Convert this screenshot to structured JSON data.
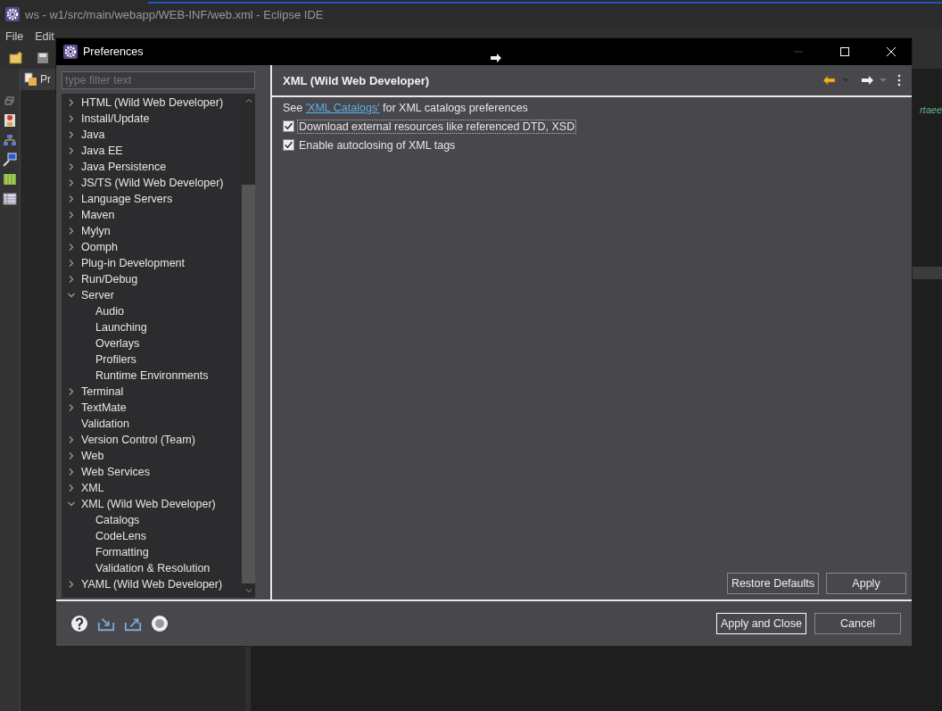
{
  "ide": {
    "title": "ws - w1/src/main/webapp/WEB-INF/web.xml - Eclipse IDE",
    "menu": [
      "File",
      "Edit"
    ],
    "explorer_tab": "Pr",
    "editor_fragment": "rtaee"
  },
  "dialog": {
    "title": "Preferences",
    "filter": {
      "placeholder": "type filter text"
    },
    "tree": [
      {
        "label": "HTML (Wild Web Developer)",
        "expanded": false
      },
      {
        "label": "Install/Update",
        "expanded": false
      },
      {
        "label": "Java",
        "expanded": false
      },
      {
        "label": "Java EE",
        "expanded": false
      },
      {
        "label": "Java Persistence",
        "expanded": false
      },
      {
        "label": "JS/TS (Wild Web Developer)",
        "expanded": false
      },
      {
        "label": "Language Servers",
        "expanded": false
      },
      {
        "label": "Maven",
        "expanded": false
      },
      {
        "label": "Mylyn",
        "expanded": false
      },
      {
        "label": "Oomph",
        "expanded": false
      },
      {
        "label": "Plug-in Development",
        "expanded": false
      },
      {
        "label": "Run/Debug",
        "expanded": false
      },
      {
        "label": "Server",
        "expanded": true,
        "children": [
          {
            "label": "Audio"
          },
          {
            "label": "Launching"
          },
          {
            "label": "Overlays"
          },
          {
            "label": "Profilers"
          },
          {
            "label": "Runtime Environments"
          }
        ]
      },
      {
        "label": "Terminal",
        "expanded": false
      },
      {
        "label": "TextMate",
        "expanded": false
      },
      {
        "label": "Validation"
      },
      {
        "label": "Version Control (Team)",
        "expanded": false
      },
      {
        "label": "Web",
        "expanded": false
      },
      {
        "label": "Web Services",
        "expanded": false
      },
      {
        "label": "XML",
        "expanded": false
      },
      {
        "label": "XML (Wild Web Developer)",
        "expanded": true,
        "children": [
          {
            "label": "Catalogs"
          },
          {
            "label": "CodeLens"
          },
          {
            "label": "Formatting"
          },
          {
            "label": "Validation & Resolution"
          }
        ]
      },
      {
        "label": "YAML (Wild Web Developer)",
        "expanded": false
      }
    ],
    "page": {
      "heading": "XML (Wild Web Developer)",
      "note": {
        "before": "See",
        "link": "'XML Catalogs'",
        "after": "for XML catalogs preferences"
      },
      "options": [
        {
          "label": "Download external resources like referenced DTD, XSD",
          "checked": true,
          "focused": true
        },
        {
          "label": "Enable autoclosing of XML tags",
          "checked": true,
          "focused": false
        }
      ],
      "buttons": [
        {
          "label": "Restore Defaults",
          "default": false
        },
        {
          "label": "Apply",
          "default": false
        }
      ]
    },
    "footer_buttons": [
      {
        "label": "Apply and Close",
        "default": true
      },
      {
        "label": "Cancel",
        "default": false
      }
    ]
  }
}
